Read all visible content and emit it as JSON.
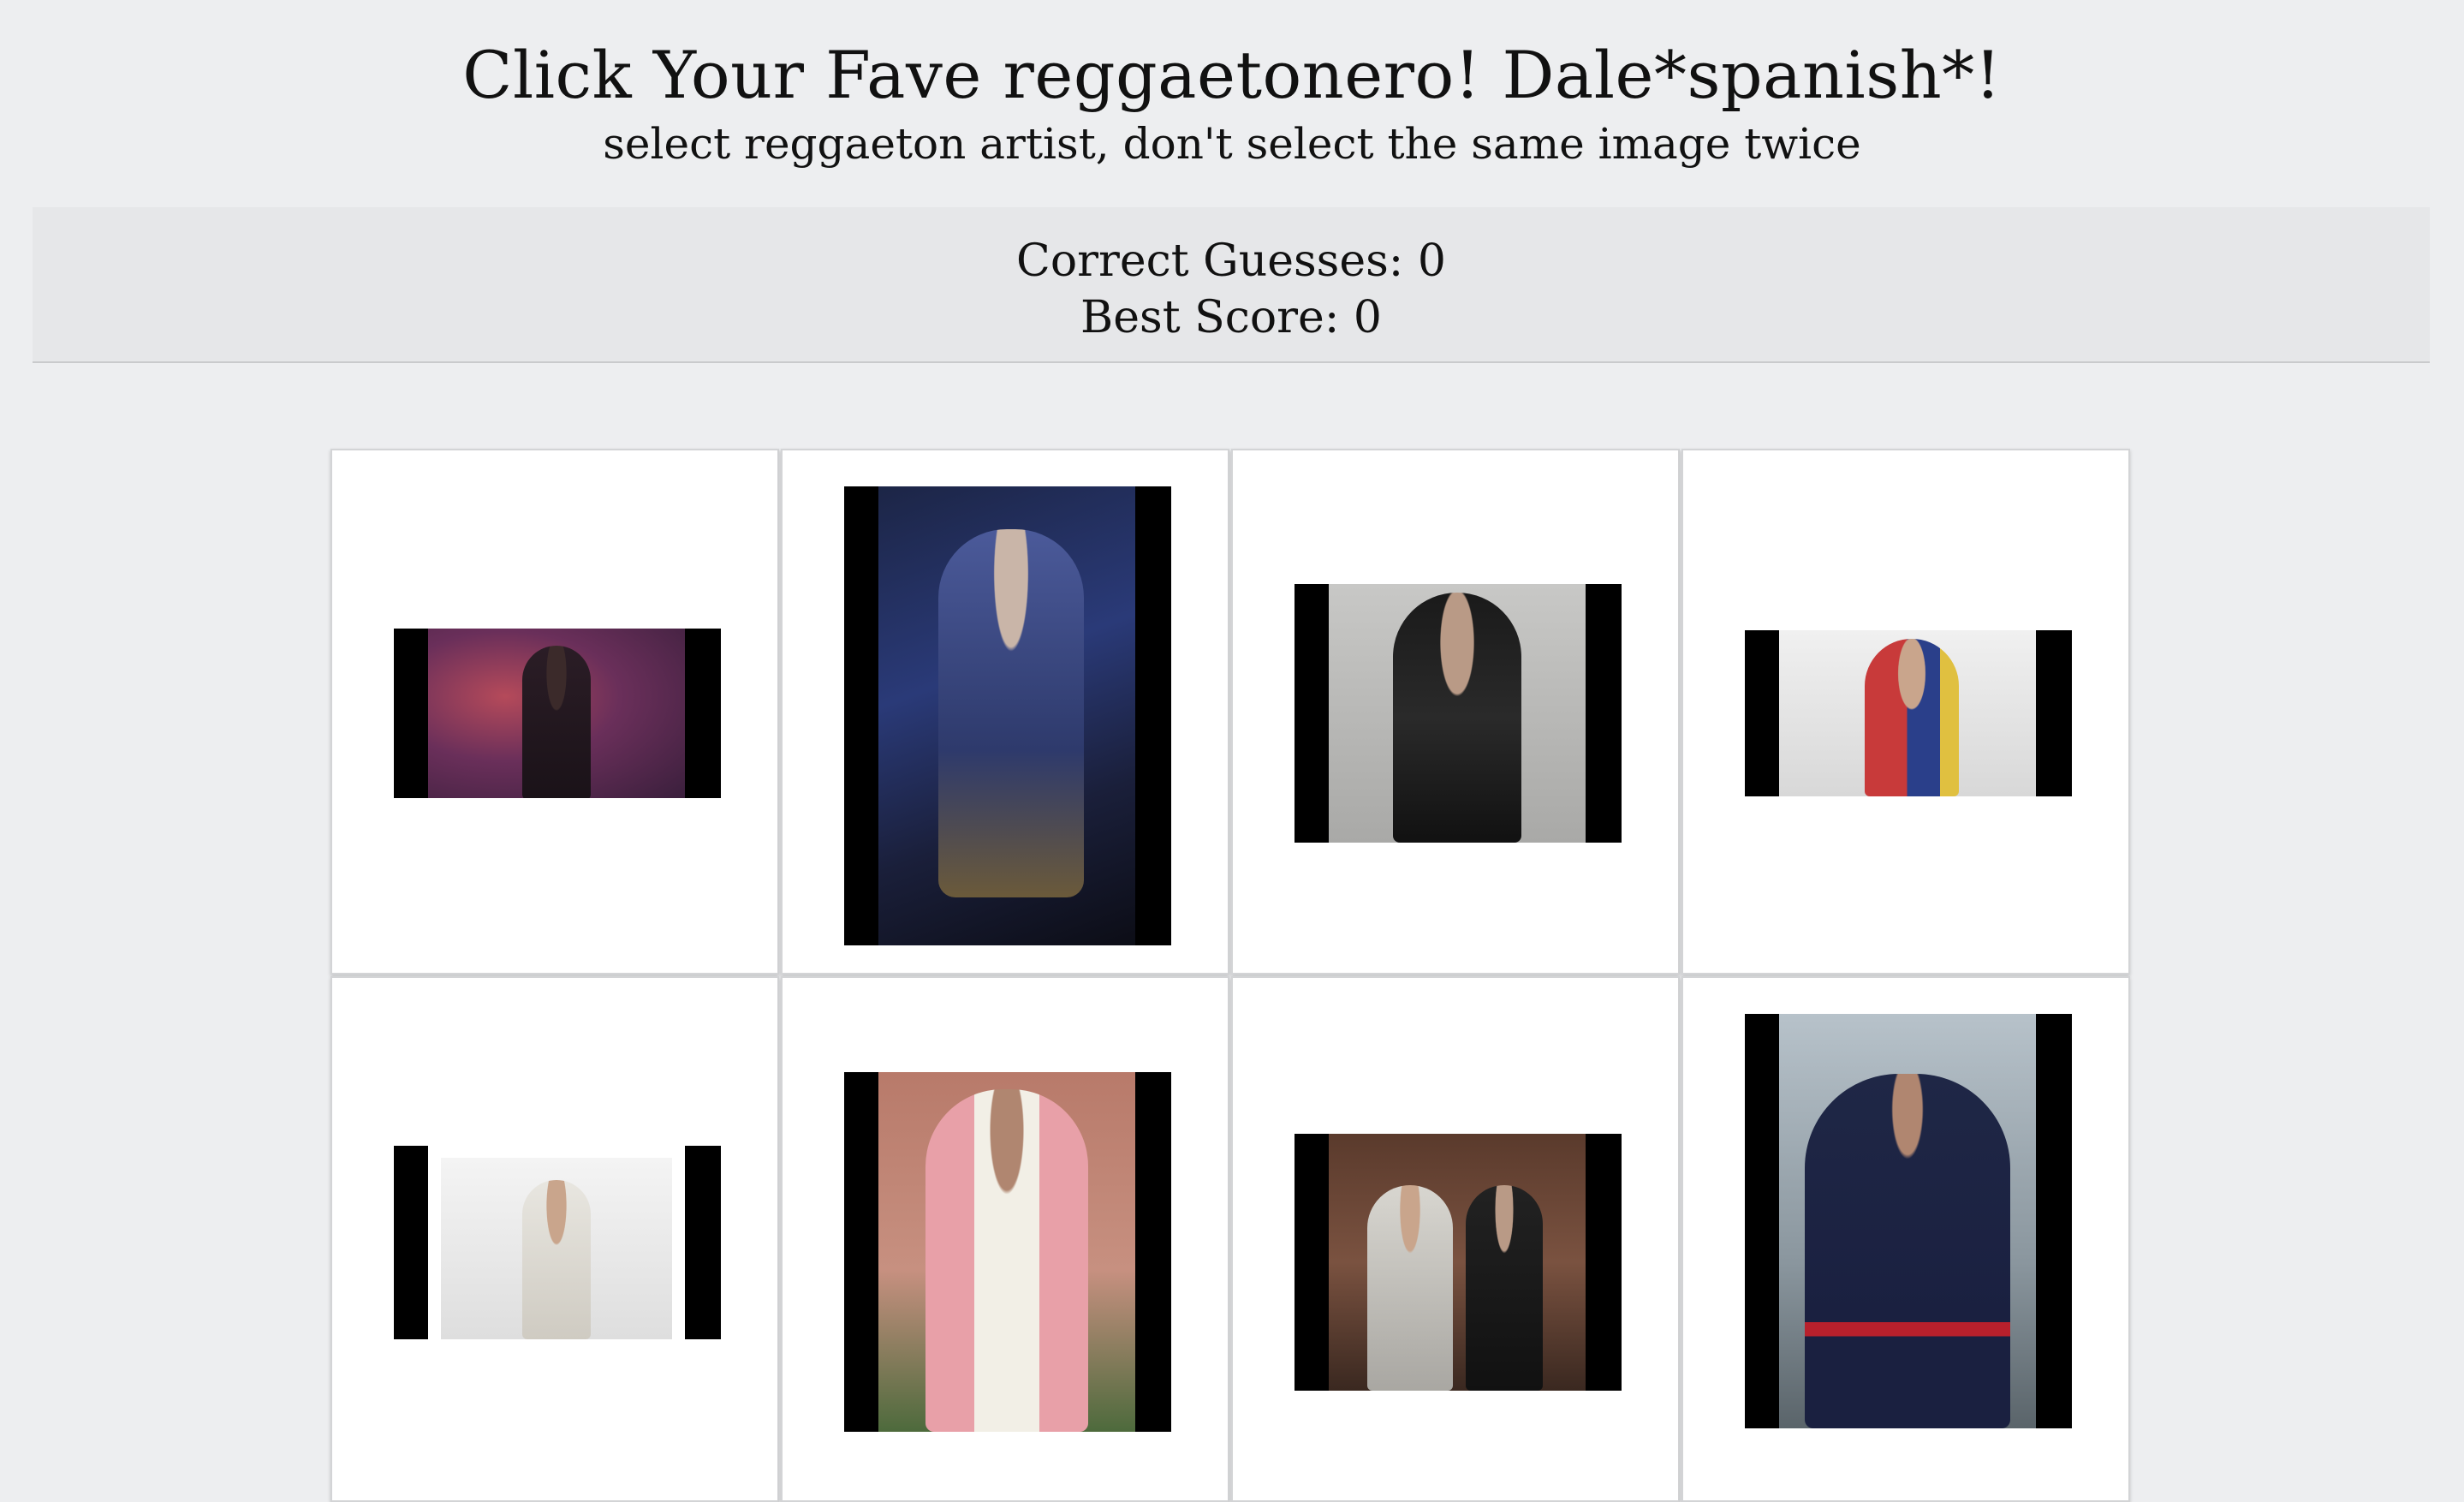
{
  "header": {
    "title": "Click Your Fave reggaetonero! Dale*spanish*!",
    "subtitle": "select reggaeton artist, don't select the same image twice"
  },
  "scoreboard": {
    "correct_label": "Correct Guesses: 0",
    "best_label": "Best Score: 0"
  },
  "cards": [
    {
      "icon": "artist-photo-1",
      "tone": "smoky purple"
    },
    {
      "icon": "artist-photo-2",
      "tone": "blue monogram suit"
    },
    {
      "icon": "artist-photo-3",
      "tone": "black hoodie sunglasses"
    },
    {
      "icon": "artist-photo-4",
      "tone": "flag jacket"
    },
    {
      "icon": "artist-photo-5",
      "tone": "white background"
    },
    {
      "icon": "artist-photo-6",
      "tone": "pink suit"
    },
    {
      "icon": "artist-photo-7",
      "tone": "two men interior"
    },
    {
      "icon": "artist-photo-8",
      "tone": "navy tracksuit"
    }
  ],
  "colors": {
    "page_bg": "#edeef0",
    "scoreboard_bg": "#e6e7e9",
    "card_bg": "#ffffff"
  }
}
